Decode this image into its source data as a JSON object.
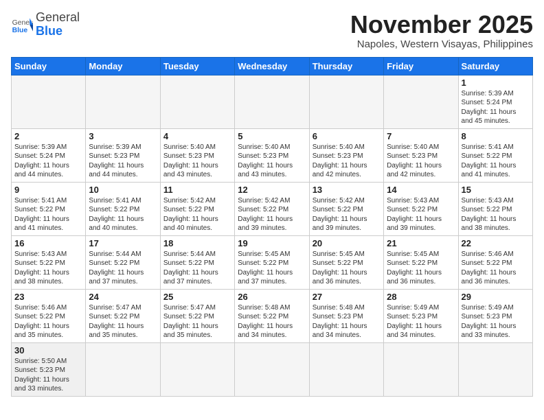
{
  "header": {
    "logo_general": "General",
    "logo_blue": "Blue",
    "month": "November 2025",
    "location": "Napoles, Western Visayas, Philippines"
  },
  "weekdays": [
    "Sunday",
    "Monday",
    "Tuesday",
    "Wednesday",
    "Thursday",
    "Friday",
    "Saturday"
  ],
  "weeks": [
    [
      {
        "day": "",
        "info": ""
      },
      {
        "day": "",
        "info": ""
      },
      {
        "day": "",
        "info": ""
      },
      {
        "day": "",
        "info": ""
      },
      {
        "day": "",
        "info": ""
      },
      {
        "day": "",
        "info": ""
      },
      {
        "day": "1",
        "info": "Sunrise: 5:39 AM\nSunset: 5:24 PM\nDaylight: 11 hours\nand 45 minutes."
      }
    ],
    [
      {
        "day": "2",
        "info": "Sunrise: 5:39 AM\nSunset: 5:24 PM\nDaylight: 11 hours\nand 44 minutes."
      },
      {
        "day": "3",
        "info": "Sunrise: 5:39 AM\nSunset: 5:23 PM\nDaylight: 11 hours\nand 44 minutes."
      },
      {
        "day": "4",
        "info": "Sunrise: 5:40 AM\nSunset: 5:23 PM\nDaylight: 11 hours\nand 43 minutes."
      },
      {
        "day": "5",
        "info": "Sunrise: 5:40 AM\nSunset: 5:23 PM\nDaylight: 11 hours\nand 43 minutes."
      },
      {
        "day": "6",
        "info": "Sunrise: 5:40 AM\nSunset: 5:23 PM\nDaylight: 11 hours\nand 42 minutes."
      },
      {
        "day": "7",
        "info": "Sunrise: 5:40 AM\nSunset: 5:23 PM\nDaylight: 11 hours\nand 42 minutes."
      },
      {
        "day": "8",
        "info": "Sunrise: 5:41 AM\nSunset: 5:22 PM\nDaylight: 11 hours\nand 41 minutes."
      }
    ],
    [
      {
        "day": "9",
        "info": "Sunrise: 5:41 AM\nSunset: 5:22 PM\nDaylight: 11 hours\nand 41 minutes."
      },
      {
        "day": "10",
        "info": "Sunrise: 5:41 AM\nSunset: 5:22 PM\nDaylight: 11 hours\nand 40 minutes."
      },
      {
        "day": "11",
        "info": "Sunrise: 5:42 AM\nSunset: 5:22 PM\nDaylight: 11 hours\nand 40 minutes."
      },
      {
        "day": "12",
        "info": "Sunrise: 5:42 AM\nSunset: 5:22 PM\nDaylight: 11 hours\nand 39 minutes."
      },
      {
        "day": "13",
        "info": "Sunrise: 5:42 AM\nSunset: 5:22 PM\nDaylight: 11 hours\nand 39 minutes."
      },
      {
        "day": "14",
        "info": "Sunrise: 5:43 AM\nSunset: 5:22 PM\nDaylight: 11 hours\nand 39 minutes."
      },
      {
        "day": "15",
        "info": "Sunrise: 5:43 AM\nSunset: 5:22 PM\nDaylight: 11 hours\nand 38 minutes."
      }
    ],
    [
      {
        "day": "16",
        "info": "Sunrise: 5:43 AM\nSunset: 5:22 PM\nDaylight: 11 hours\nand 38 minutes."
      },
      {
        "day": "17",
        "info": "Sunrise: 5:44 AM\nSunset: 5:22 PM\nDaylight: 11 hours\nand 37 minutes."
      },
      {
        "day": "18",
        "info": "Sunrise: 5:44 AM\nSunset: 5:22 PM\nDaylight: 11 hours\nand 37 minutes."
      },
      {
        "day": "19",
        "info": "Sunrise: 5:45 AM\nSunset: 5:22 PM\nDaylight: 11 hours\nand 37 minutes."
      },
      {
        "day": "20",
        "info": "Sunrise: 5:45 AM\nSunset: 5:22 PM\nDaylight: 11 hours\nand 36 minutes."
      },
      {
        "day": "21",
        "info": "Sunrise: 5:45 AM\nSunset: 5:22 PM\nDaylight: 11 hours\nand 36 minutes."
      },
      {
        "day": "22",
        "info": "Sunrise: 5:46 AM\nSunset: 5:22 PM\nDaylight: 11 hours\nand 36 minutes."
      }
    ],
    [
      {
        "day": "23",
        "info": "Sunrise: 5:46 AM\nSunset: 5:22 PM\nDaylight: 11 hours\nand 35 minutes."
      },
      {
        "day": "24",
        "info": "Sunrise: 5:47 AM\nSunset: 5:22 PM\nDaylight: 11 hours\nand 35 minutes."
      },
      {
        "day": "25",
        "info": "Sunrise: 5:47 AM\nSunset: 5:22 PM\nDaylight: 11 hours\nand 35 minutes."
      },
      {
        "day": "26",
        "info": "Sunrise: 5:48 AM\nSunset: 5:22 PM\nDaylight: 11 hours\nand 34 minutes."
      },
      {
        "day": "27",
        "info": "Sunrise: 5:48 AM\nSunset: 5:23 PM\nDaylight: 11 hours\nand 34 minutes."
      },
      {
        "day": "28",
        "info": "Sunrise: 5:49 AM\nSunset: 5:23 PM\nDaylight: 11 hours\nand 34 minutes."
      },
      {
        "day": "29",
        "info": "Sunrise: 5:49 AM\nSunset: 5:23 PM\nDaylight: 11 hours\nand 33 minutes."
      }
    ],
    [
      {
        "day": "30",
        "info": "Sunrise: 5:50 AM\nSunset: 5:23 PM\nDaylight: 11 hours\nand 33 minutes."
      },
      {
        "day": "",
        "info": ""
      },
      {
        "day": "",
        "info": ""
      },
      {
        "day": "",
        "info": ""
      },
      {
        "day": "",
        "info": ""
      },
      {
        "day": "",
        "info": ""
      },
      {
        "day": "",
        "info": ""
      }
    ]
  ]
}
